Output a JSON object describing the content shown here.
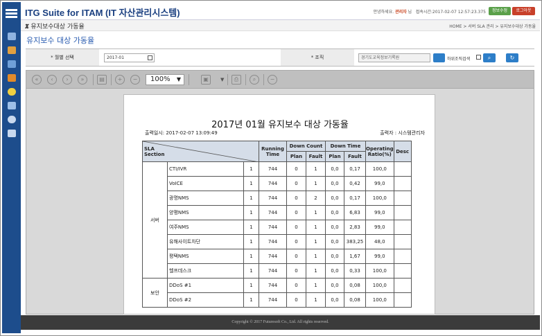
{
  "app": {
    "title": "ITG Suite for ITAM (IT 자산관리시스템)"
  },
  "header": {
    "greeting": "안녕하세요.",
    "user": "관리자",
    "suffix": "님",
    "login_time": "접속시간:2017-02-07 12:57:23.375",
    "info_btn": "정보수정",
    "logout_btn": "로그아웃"
  },
  "breadcrumb": {
    "section_title": "유지보수대상 가동율",
    "path": "HOME > 서버 SLA 관리 > 유지보수대상 가동율"
  },
  "page": {
    "title": "유지보수 대상 가동율"
  },
  "filters": {
    "month_label": "* 월별 선택",
    "month_value": "2017-01",
    "org_label": "* 조직",
    "org_value": "경기도교육정보기록원",
    "sub_org_label": "하위조직검색"
  },
  "viewer": {
    "zoom": "100%"
  },
  "report": {
    "title": "2017년 01월 유지보수 대상 가동율",
    "printed": "출력일시:  2017-02-07   13:09:49",
    "printer": "출력자 : 시스템관리자",
    "headers": {
      "sla": "SLA",
      "section": "Section",
      "running": "Running Time",
      "down_count": "Down Count",
      "down_time": "Down Time",
      "plan": "Plan",
      "fault": "Fault",
      "operating": "Operating Ratio(%)",
      "desc": "Desc"
    },
    "groups": [
      {
        "name": "서버",
        "rows": [
          {
            "item": "CTI/IVR",
            "n": "1",
            "run": "744",
            "cp": "0",
            "cf": "1",
            "tp": "0,0",
            "tf": "0,17",
            "ratio": "100,0"
          },
          {
            "item": "VoICE",
            "n": "1",
            "run": "744",
            "cp": "0",
            "cf": "1",
            "tp": "0,0",
            "tf": "0,42",
            "ratio": "99,0"
          },
          {
            "item": "광명NMS",
            "n": "1",
            "run": "744",
            "cp": "0",
            "cf": "2",
            "tp": "0,0",
            "tf": "0,17",
            "ratio": "100,0"
          },
          {
            "item": "양평NMS",
            "n": "1",
            "run": "744",
            "cp": "0",
            "cf": "1",
            "tp": "0,0",
            "tf": "6,83",
            "ratio": "99,0"
          },
          {
            "item": "여주NMS",
            "n": "1",
            "run": "744",
            "cp": "0",
            "cf": "1",
            "tp": "0,0",
            "tf": "2,83",
            "ratio": "99,0"
          },
          {
            "item": "유해사이트차단",
            "n": "1",
            "run": "744",
            "cp": "0",
            "cf": "1",
            "tp": "0,0",
            "tf": "383,25",
            "ratio": "48,0"
          },
          {
            "item": "평택NMS",
            "n": "1",
            "run": "744",
            "cp": "0",
            "cf": "1",
            "tp": "0,0",
            "tf": "1,67",
            "ratio": "99,0"
          },
          {
            "item": "헬프데스크",
            "n": "1",
            "run": "744",
            "cp": "0",
            "cf": "1",
            "tp": "0,0",
            "tf": "0,33",
            "ratio": "100,0"
          }
        ]
      },
      {
        "name": "보안",
        "rows": [
          {
            "item": "DDoS #1",
            "n": "1",
            "run": "744",
            "cp": "0",
            "cf": "1",
            "tp": "0,0",
            "tf": "0,08",
            "ratio": "100,0"
          },
          {
            "item": "DDoS #2",
            "n": "1",
            "run": "744",
            "cp": "0",
            "cf": "1",
            "tp": "0,0",
            "tf": "0,08",
            "ratio": "100,0"
          }
        ]
      }
    ]
  },
  "footer": {
    "text": "Copyright © 2017 Futuresoft Co., Ltd. All rights reserved."
  }
}
